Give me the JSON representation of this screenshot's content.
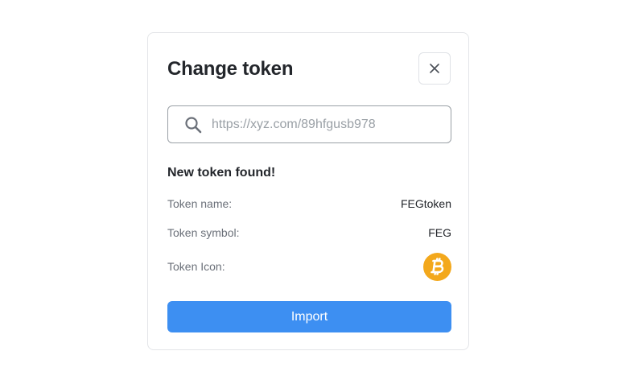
{
  "modal": {
    "title": "Change token",
    "close_icon": "close-icon",
    "search": {
      "placeholder": "https://xyz.com/89hfgusb978",
      "value": "",
      "icon": "search-icon"
    },
    "found_title": "New token found!",
    "details": [
      {
        "label": "Token name:",
        "value": "FEGtoken"
      },
      {
        "label": "Token symbol:",
        "value": "FEG"
      },
      {
        "label": "Token Icon:",
        "icon": "bitcoin-icon"
      }
    ],
    "import_label": "Import"
  },
  "colors": {
    "accent": "#3d8ff2",
    "coin": "#f3a81c",
    "border": "#e3e5e8",
    "muted_text": "#6b7079"
  }
}
